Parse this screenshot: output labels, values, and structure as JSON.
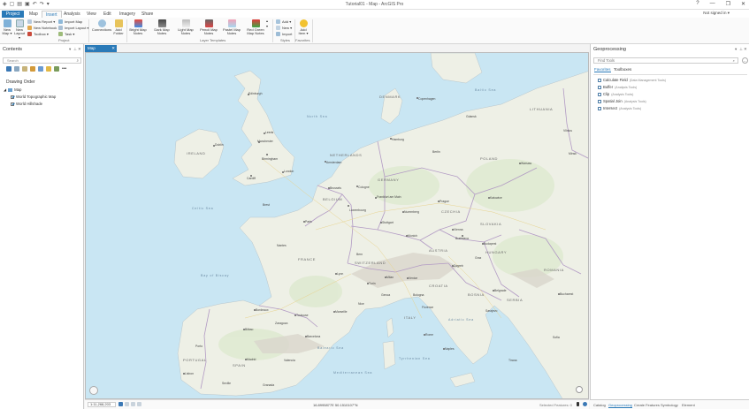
{
  "window": {
    "title": "Tutorial01 - Map - ArcGIS Pro",
    "signin": "Not signed in ▾",
    "controls": [
      "?",
      "—",
      "❐",
      "✕"
    ]
  },
  "tabs": [
    "Project",
    "Map",
    "Insert",
    "Analysis",
    "View",
    "Edit",
    "Imagery",
    "Share"
  ],
  "active_tab": "Insert",
  "ribbon": {
    "new_map": "New Map ▾",
    "new_layout": "New Layout ▾",
    "new_report": "New Report ▾",
    "new_notebook": "New Notebook",
    "toolbox": "Toolbox ▾",
    "import_map": "Import Map",
    "import_layout": "Import Layout ▾",
    "task": "Task ▾",
    "connections": "Connections",
    "add_folder": "Add Folder",
    "group_project": "Project",
    "templates": [
      "Bright Map Notes",
      "Dark Map Notes",
      "Light Map Notes",
      "Pencil Map Notes",
      "Pastel Map Notes",
      "Red Green Map Notes"
    ],
    "group_layer_templates": "Layer Templates",
    "style_add": "Add ▾",
    "style_new": "New ▾",
    "style_import": "Import",
    "group_styles": "Styles",
    "add_item": "Add Item ▾",
    "group_favorites": "Favorites"
  },
  "contents": {
    "title": "Contents",
    "search_placeholder": "Search",
    "drawing_order": "Drawing Order",
    "map_name": "Map",
    "layers": [
      "World Topographic Map",
      "World Hillshade"
    ]
  },
  "map": {
    "tab_label": "Map",
    "countries": [
      "IRELAND",
      "DENMARK",
      "NETHERLANDS",
      "GERMANY",
      "POLAND",
      "BELGIUM",
      "CZECHIA",
      "FRANCE",
      "AUSTRIA",
      "HUNGARY",
      "ROMANIA",
      "SWITZERLAND",
      "ITALY",
      "CROATIA",
      "SERBIA",
      "SPAIN",
      "PORTUGAL",
      "SLOVAKIA",
      "LITHUANIA",
      "BOSNIA"
    ],
    "cities": [
      "Edinburgh",
      "Leeds",
      "Manchester",
      "Birmingham",
      "Cardiff",
      "London",
      "Dublin",
      "Copenhagen",
      "Hamburg",
      "Amsterdam",
      "Brussels",
      "Cologne",
      "Frankfurt am Main",
      "Luxembourg",
      "Paris",
      "Prague",
      "Nuremberg",
      "Stuttgart",
      "Munich",
      "Vienna",
      "Bratislava",
      "Budapest",
      "Warsaw",
      "Katowice",
      "Lyon",
      "Turin",
      "Milan",
      "Venice",
      "Zagreb",
      "Belgrade",
      "Bucharest",
      "Bordeaux",
      "Bilbao",
      "Toulouse",
      "Marseille",
      "Barcelona",
      "Madrid",
      "Rome",
      "Naples",
      "Lisbon",
      "Porto",
      "Berlin",
      "Brest",
      "Nantes",
      "Valencia",
      "Seville",
      "Sofia",
      "Vilnius",
      "Minsk",
      "Gdansk",
      "Bern",
      "Graz",
      "Sarajevo",
      "Bologna",
      "Florence",
      "Genoa",
      "Nice",
      "Zaragoza",
      "Granada",
      "Tirana"
    ],
    "seas": [
      "North Sea",
      "Bay of Biscay",
      "Mediterranean Sea",
      "Adriatic Sea",
      "Tyrrhenian Sea",
      "Balearic Sea",
      "Celtic Sea",
      "Baltic Sea"
    ]
  },
  "status": {
    "scale": "1:11,268,203",
    "coordinates": "16.8995877E 50.1510107°N",
    "selected": "Selected Features: 0"
  },
  "geoprocessing": {
    "title": "Geoprocessing",
    "search_placeholder": "Find Tools",
    "tabs": [
      "Favorites",
      "Toolboxes"
    ],
    "tools": [
      {
        "name": "Calculate Field",
        "box": "(Data Management Tools)"
      },
      {
        "name": "Buffer",
        "box": "(Analysis Tools)"
      },
      {
        "name": "Clip",
        "box": "(Analysis Tools)"
      },
      {
        "name": "Spatial Join",
        "box": "(Analysis Tools)"
      },
      {
        "name": "Intersect",
        "box": "(Analysis Tools)"
      }
    ]
  },
  "bottom_tabs": [
    "Catalog",
    "Geoprocessing",
    "Create Features",
    "Symbology",
    "Element"
  ],
  "colors": {
    "accent": "#2a7ab8",
    "water": "#c9e6f3",
    "land": "#eef0e6",
    "forest": "#dbe8cc",
    "mountain": "#dad6cc",
    "border": "#b29ac4"
  }
}
